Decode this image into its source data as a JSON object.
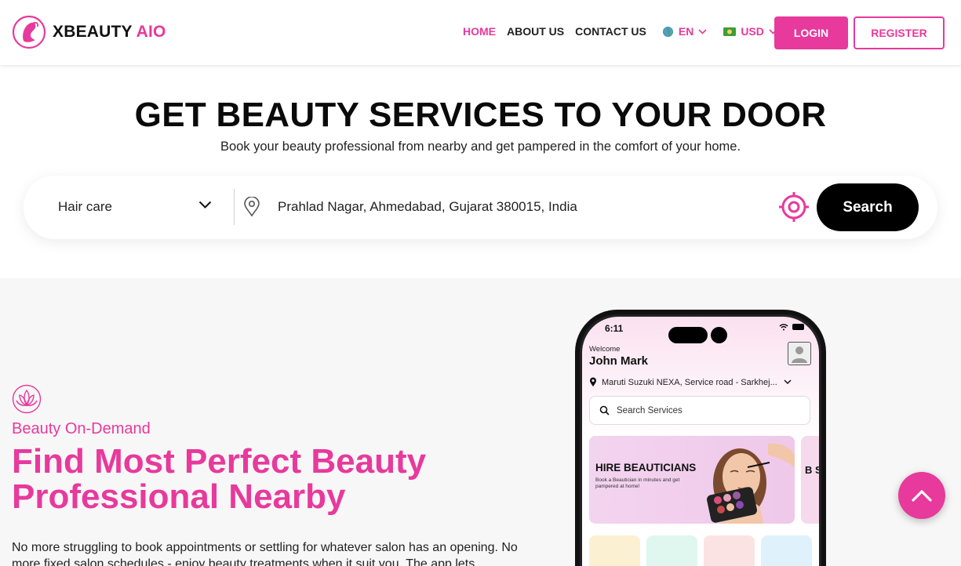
{
  "brand": {
    "name_part1": "XBEAUTY",
    "name_part2": "AIO",
    "accent": "#e8399c"
  },
  "nav": {
    "items": [
      {
        "label": "HOME",
        "active": true
      },
      {
        "label": "ABOUT US",
        "active": false
      },
      {
        "label": "CONTACT US",
        "active": false
      }
    ],
    "language": {
      "icon": "globe-icon",
      "value": "EN"
    },
    "currency": {
      "icon": "banknote-icon",
      "value": "USD"
    },
    "login_label": "LOGIN",
    "register_label": "REGISTER"
  },
  "hero": {
    "title": "GET BEAUTY SERVICES TO YOUR DOOR",
    "subtitle": "Book your beauty professional from nearby and get pampered in the comfort of your home."
  },
  "search": {
    "category_value": "Hair care",
    "location_value": "Prahlad Nagar, Ahmedabad, Gujarat 380015, India",
    "search_label": "Search"
  },
  "feature": {
    "kicker": "Beauty On-Demand",
    "headline": "Find Most Perfect Beauty Professional Nearby",
    "paragraph": "No more struggling to book appointments or settling for whatever salon has an opening. No more fixed salon schedules - enjoy beauty treatments when it suit you. The app lets"
  },
  "phone": {
    "time": "6:11",
    "welcome": "Welcome",
    "username": "John Mark",
    "address": "Maruti Suzuki NEXA, Service road - Sarkhej...",
    "search_placeholder": "Search Services",
    "banner_title": "HIRE BEAUTICIANS",
    "banner_subtitle": "Book a Beautician in minutes and get pampered at home!",
    "banner2_title": "B S"
  }
}
